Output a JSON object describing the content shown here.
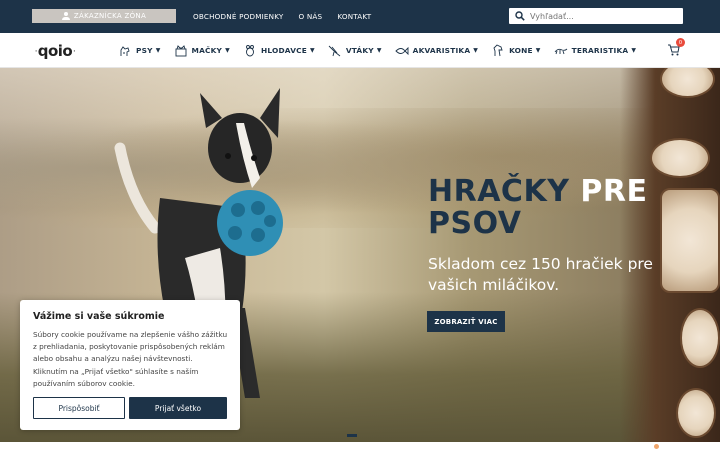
{
  "topbar": {
    "customer_zone_label": "ZÁKAZNÍCKA ZÓNA",
    "links": [
      "OBCHODNÉ PODMIENKY",
      "O NÁS",
      "KONTAKT"
    ],
    "search_placeholder": "Vyhľadať..."
  },
  "nav": {
    "logo_text": "qoio",
    "menu": [
      {
        "label": "PSY",
        "icon": "dog-icon"
      },
      {
        "label": "MAČKY",
        "icon": "cat-icon"
      },
      {
        "label": "HLODAVCE",
        "icon": "rodent-icon"
      },
      {
        "label": "VTÁKY",
        "icon": "bird-icon"
      },
      {
        "label": "AKVARISTIKA",
        "icon": "fish-icon"
      },
      {
        "label": "KONE",
        "icon": "horse-icon"
      },
      {
        "label": "TERARISTIKA",
        "icon": "reptile-icon"
      }
    ],
    "cart_count": "0"
  },
  "hero": {
    "title_part1": "HRAČKY",
    "title_part2": "PRE",
    "title_part3": "PSOV",
    "subtitle": "Skladom cez 150 hračiek pre vašich miláčikov.",
    "button_label": "ZOBRAZIŤ VIAC"
  },
  "cookie": {
    "title": "Vážime si vaše súkromie",
    "text": "Súbory cookie používame na zlepšenie vášho zážitku z prehliadania, poskytovanie prispôsobených reklám alebo obsahu a analýzu našej návštevnosti. Kliknutím na „Prijať všetko\" súhlasíte s naším používaním súborov cookie.",
    "customize_label": "Prispôsobiť",
    "accept_label": "Prijať všetko"
  },
  "colors": {
    "primary": "#1d3348",
    "zone_button": "#c9c5c0",
    "cart_badge": "#e94b3c"
  }
}
